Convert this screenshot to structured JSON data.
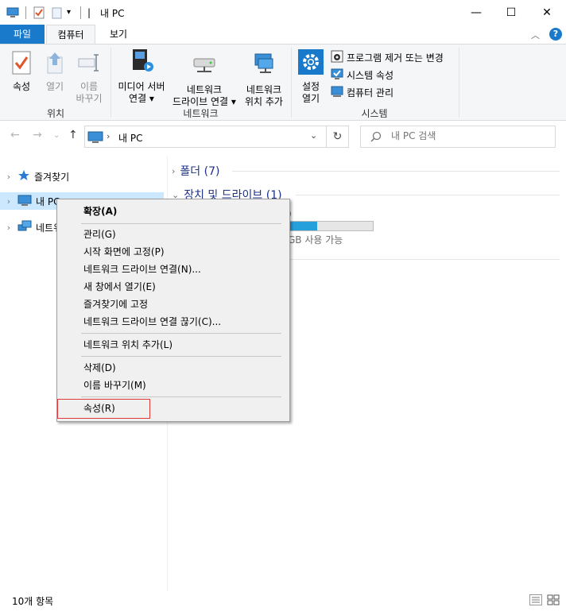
{
  "window": {
    "title": "내 PC",
    "minimize": "—",
    "maximize": "☐",
    "close": "✕"
  },
  "ribbon_tabs": {
    "file": "파일",
    "computer": "컴퓨터",
    "view": "보기"
  },
  "ribbon": {
    "location": {
      "properties": "속성",
      "open": "열기",
      "rename_line1": "이름",
      "rename_line2": "바꾸기",
      "group_label": "위치"
    },
    "network": {
      "media_server_line1": "미디어 서버",
      "media_server_line2": "연결 ▾",
      "map_drive_line1": "네트워크",
      "map_drive_line2": "드라이브 연결 ▾",
      "add_location_line1": "네트워크",
      "add_location_line2": "위치 추가",
      "group_label": "네트워크"
    },
    "system": {
      "settings_line1": "설정",
      "settings_line2": "열기",
      "uninstall": "프로그램 제거 또는 변경",
      "system_properties": "시스템 속성",
      "manage": "컴퓨터 관리",
      "group_label": "시스템"
    }
  },
  "address": {
    "crumb": "내 PC",
    "search_placeholder": "내 PC 검색"
  },
  "nav_pane": {
    "items": [
      {
        "label": "즐겨찾기",
        "icon": "star-icon"
      },
      {
        "label": "내 PC",
        "icon": "computer-icon",
        "selected": true
      },
      {
        "label": "네트워크",
        "icon": "network-icon"
      }
    ]
  },
  "content": {
    "folders_header": "폴더 (7)",
    "devices_header": "장치 및 드라이브 (1)",
    "drive_name_fragment": ")",
    "drive_free_fragment": "GB 사용 가능",
    "drive_usage_fraction": 0.6
  },
  "context_menu": {
    "items": [
      {
        "label": "확장(A)",
        "bold": true
      },
      {
        "label": "관리(G)"
      },
      {
        "label": "시작 화면에 고정(P)"
      },
      {
        "label": "네트워크 드라이브 연결(N)..."
      },
      {
        "label": "새 창에서 열기(E)"
      },
      {
        "label": "즐겨찾기에 고정"
      },
      {
        "label": "네트워크 드라이브 연결 끊기(C)..."
      },
      {
        "label": "네트워크 위치 추가(L)"
      },
      {
        "label": "삭제(D)"
      },
      {
        "label": "이름 바꾸기(M)"
      },
      {
        "label": "속성(R)",
        "highlighted": true
      }
    ]
  },
  "status_bar": {
    "item_count": "10개 항목"
  },
  "colors": {
    "accent": "#1979ca",
    "selection": "#cce8ff",
    "highlight_border": "#e03a3a",
    "drive_fill": "#26a0da"
  }
}
